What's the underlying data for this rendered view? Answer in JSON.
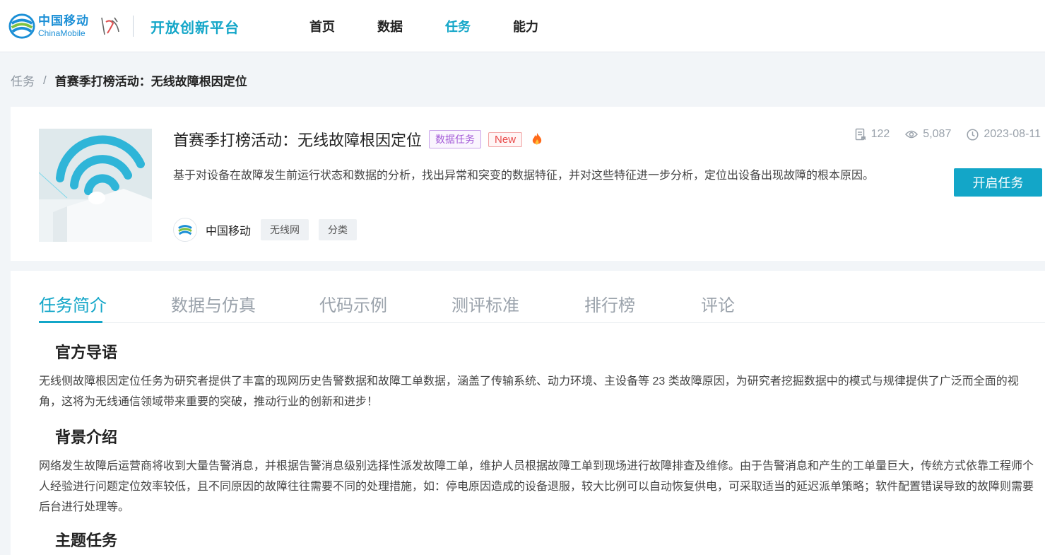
{
  "brand": {
    "logo_cn": "中国移动",
    "logo_en": "ChinaMobile",
    "platform": "开放创新平台",
    "accent": "#13a6c8"
  },
  "nav": {
    "items": [
      {
        "label": "首页",
        "active": false
      },
      {
        "label": "数据",
        "active": false
      },
      {
        "label": "任务",
        "active": true
      },
      {
        "label": "能力",
        "active": false
      }
    ]
  },
  "breadcrumb": {
    "root": "任务",
    "separator": "/",
    "current": "首赛季打榜活动：无线故障根因定位"
  },
  "task": {
    "title": "首赛季打榜活动：无线故障根因定位",
    "type_tag": "数据任务",
    "new_tag": "New",
    "hot_icon": "fire-icon",
    "description": "基于对设备在故障发生前运行状态和数据的分析，找出异常和突变的数据特征，并对这些特征进一步分析，定位出设备出现故障的根本原因。",
    "org_name": "中国移动",
    "tags": [
      "无线网",
      "分类"
    ],
    "stats": {
      "submissions": "122",
      "views": "5,087",
      "date": "2023-08-11"
    },
    "start_button": "开启任务"
  },
  "tabs": [
    {
      "label": "任务简介",
      "active": true
    },
    {
      "label": "数据与仿真",
      "active": false
    },
    {
      "label": "代码示例",
      "active": false
    },
    {
      "label": "测评标准",
      "active": false
    },
    {
      "label": "排行榜",
      "active": false
    },
    {
      "label": "评论",
      "active": false
    }
  ],
  "content": {
    "intro_heading": "官方导语",
    "intro_text": "无线侧故障根因定位任务为研究者提供了丰富的现网历史告警数据和故障工单数据，涵盖了传输系统、动力环境、主设备等 23 类故障原因，为研究者挖掘数据中的模式与规律提供了广泛而全面的视角，这将为无线通信领域带来重要的突破，推动行业的创新和进步！",
    "background_heading": "背景介绍",
    "background_text": "网络发生故障后运营商将收到大量告警消息，并根据告警消息级别选择性派发故障工单，维护人员根据故障工单到现场进行故障排查及维修。由于告警消息和产生的工单量巨大，传统方式依靠工程师个人经验进行问题定位效率较低，且不同原因的故障往往需要不同的处理措施，如：停电原因造成的设备退服，较大比例可以自动恢复供电，可采取适当的延迟派单策略；软件配置错误导致的故障则需要后台进行处理等。",
    "theme_heading": "主题任务"
  }
}
